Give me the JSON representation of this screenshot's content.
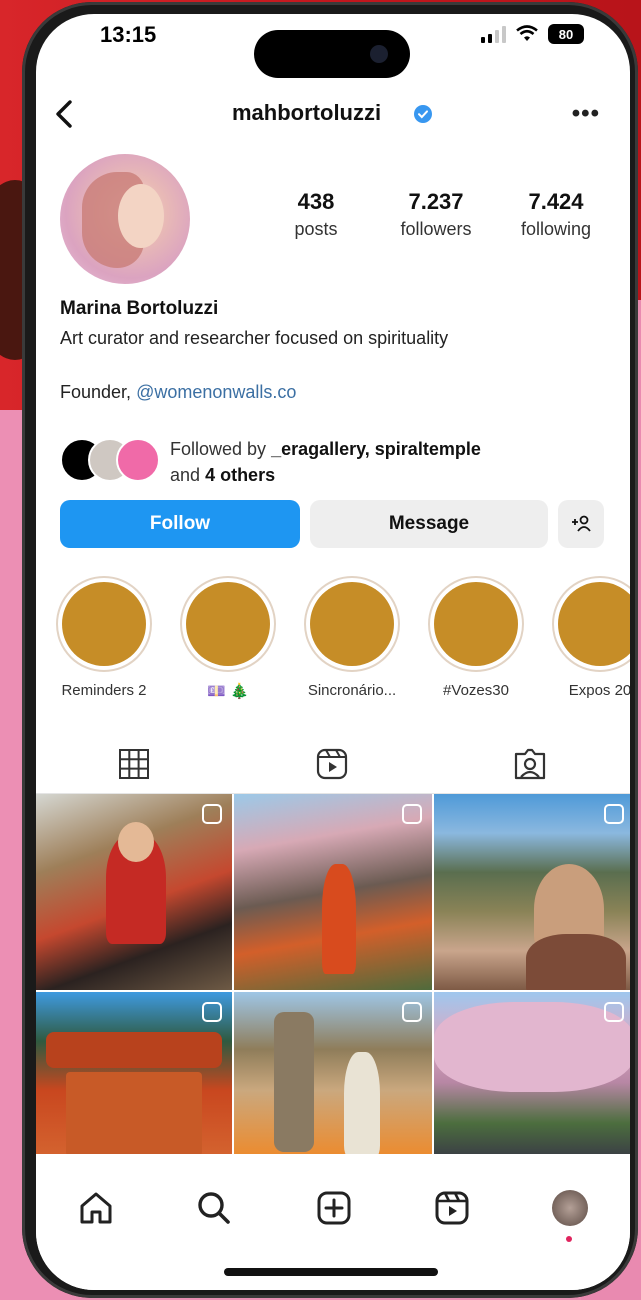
{
  "status_bar": {
    "time": "13:15",
    "battery": "80"
  },
  "header": {
    "username": "mahbortoluzzi"
  },
  "profile": {
    "stats": [
      {
        "value": "438",
        "label": "posts"
      },
      {
        "value": "7.237",
        "label": "followers"
      },
      {
        "value": "7.424",
        "label": "following"
      }
    ],
    "name": "Marina Bortoluzzi",
    "bio": "Art curator and researcher focused on spirituality",
    "founder_prefix": "Founder,",
    "founder_link": "@womenonwalls.co",
    "followed_by_prefix": "Followed by",
    "followed_by_names": "_eragallery, spiraltemple",
    "followed_by_and": "and",
    "followed_by_others": "4 others"
  },
  "actions": {
    "follow": "Follow",
    "message": "Message",
    "add_person": "+👤"
  },
  "highlights": [
    {
      "label": "Reminders 2"
    },
    {
      "label": "💷 🎄"
    },
    {
      "label": "Sincronário..."
    },
    {
      "label": "#Vozes30"
    },
    {
      "label": "Expos 20"
    }
  ],
  "colors": {
    "follow_blue": "#1e96f2",
    "highlight_gold": "#c68d27",
    "link_blue": "#3b6fa3"
  }
}
